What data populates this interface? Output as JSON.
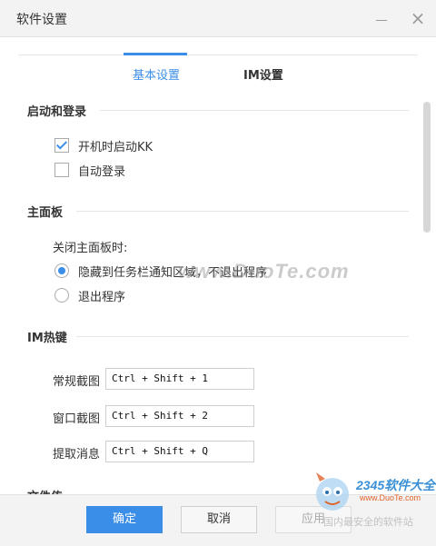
{
  "window": {
    "title": "软件设置",
    "minimize_label": "",
    "close_label": "×"
  },
  "tabs": [
    {
      "label": "基本设置",
      "active": true
    },
    {
      "label": "IM设置",
      "active": false
    }
  ],
  "sections": {
    "startup": {
      "title": "启动和登录",
      "options": [
        {
          "label": "开机时启动KK",
          "checked": true
        },
        {
          "label": "自动登录",
          "checked": false
        }
      ]
    },
    "main_panel": {
      "title": "主面板",
      "prompt": "关闭主面板时:",
      "options": [
        {
          "label": "隐藏到任务栏通知区域，不退出程序",
          "selected": true
        },
        {
          "label": "退出程序",
          "selected": false
        }
      ]
    },
    "hotkeys": {
      "title": "IM热键",
      "items": [
        {
          "label": "常规截图",
          "value": "Ctrl + Shift + 1"
        },
        {
          "label": "窗口截图",
          "value": "Ctrl + Shift + 2"
        },
        {
          "label": "提取消息",
          "value": "Ctrl + Shift + Q"
        }
      ]
    },
    "next_title_partial": "文件传"
  },
  "footer": {
    "ok_label": "确定",
    "cancel_label": "取消",
    "apply_label": "应用"
  },
  "watermarks": {
    "center": "www.DuoTe.com",
    "logo_brand": "2345软件大全",
    "logo_url": "www.DuoTe.com",
    "logo_sub": "国内最安全的软件站"
  },
  "colors": {
    "accent": "#3b8ee8",
    "titlebar_bg": "#f3f3f3",
    "footer_bg": "#f3f3f3"
  },
  "icons": {
    "minimize": "minimize-icon",
    "close": "close-icon",
    "checkbox_checked": "checkbox-checked-icon",
    "radio_selected": "radio-selected-icon"
  }
}
